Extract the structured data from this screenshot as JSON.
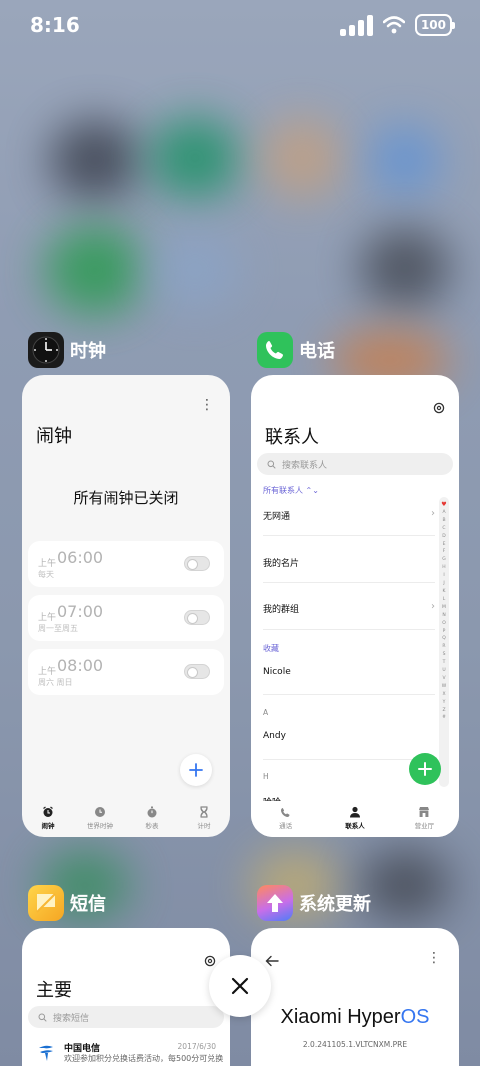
{
  "status_bar": {
    "time": "8:16",
    "battery": "100"
  },
  "apps": {
    "clock": {
      "name": "时钟"
    },
    "phone": {
      "name": "电话"
    },
    "messages": {
      "name": "短信"
    },
    "updater": {
      "name": "系统更新"
    }
  },
  "clock_card": {
    "title": "闹钟",
    "menu": "⋮",
    "empty_text": "所有闹钟已关闭",
    "alarms": [
      {
        "ampm": "上午",
        "time": "06:00",
        "repeat": "每天",
        "enabled": false
      },
      {
        "ampm": "上午",
        "time": "07:00",
        "repeat": "周一至周五",
        "enabled": false
      },
      {
        "ampm": "上午",
        "time": "08:00",
        "repeat": "周六 周日",
        "enabled": false
      }
    ],
    "tabs": [
      {
        "label": "闹钟",
        "icon": "alarm-icon"
      },
      {
        "label": "世界时钟",
        "icon": "world-clock-icon"
      },
      {
        "label": "秒表",
        "icon": "stopwatch-icon"
      },
      {
        "label": "计时",
        "icon": "timer-icon"
      }
    ],
    "accent": "#3576f0"
  },
  "phone_card": {
    "title": "联系人",
    "search_placeholder": "搜索联系人",
    "filter": "所有联系人 ⌃⌄",
    "rows": [
      {
        "label": "无网通",
        "chevron": "›"
      },
      {
        "label": "我的名片"
      },
      {
        "label": "我的群组",
        "chevron": "›"
      }
    ],
    "favorites_header": "收藏",
    "favorites": [
      "Nicole"
    ],
    "section_a": "A",
    "contacts_a": [
      "Andy"
    ],
    "section_h": "H",
    "contacts_h": [
      "哈哈"
    ],
    "alphabet": [
      "♥",
      "A",
      "B",
      "C",
      "D",
      "E",
      "F",
      "G",
      "H",
      "I",
      "J",
      "K",
      "L",
      "M",
      "N",
      "O",
      "P",
      "Q",
      "R",
      "S",
      "T",
      "U",
      "V",
      "W",
      "X",
      "Y",
      "Z",
      "#"
    ],
    "tabs": [
      {
        "label": "通话",
        "icon": "phone-call-icon"
      },
      {
        "label": "联系人",
        "icon": "contacts-icon"
      },
      {
        "label": "营业厅",
        "icon": "store-icon"
      }
    ],
    "accent": "#2fc25b"
  },
  "messages_card": {
    "title": "主要",
    "search_placeholder": "搜索短信",
    "item": {
      "name": "中国电信",
      "date": "2017/6/30",
      "preview": "欢迎参加积分兑换话费活动，每500分可兑换"
    }
  },
  "updater_card": {
    "brand_main": "Xiaomi Hyper",
    "brand_os": "OS",
    "version": "2.0.241105.1.VLTCNXM.PRE"
  }
}
